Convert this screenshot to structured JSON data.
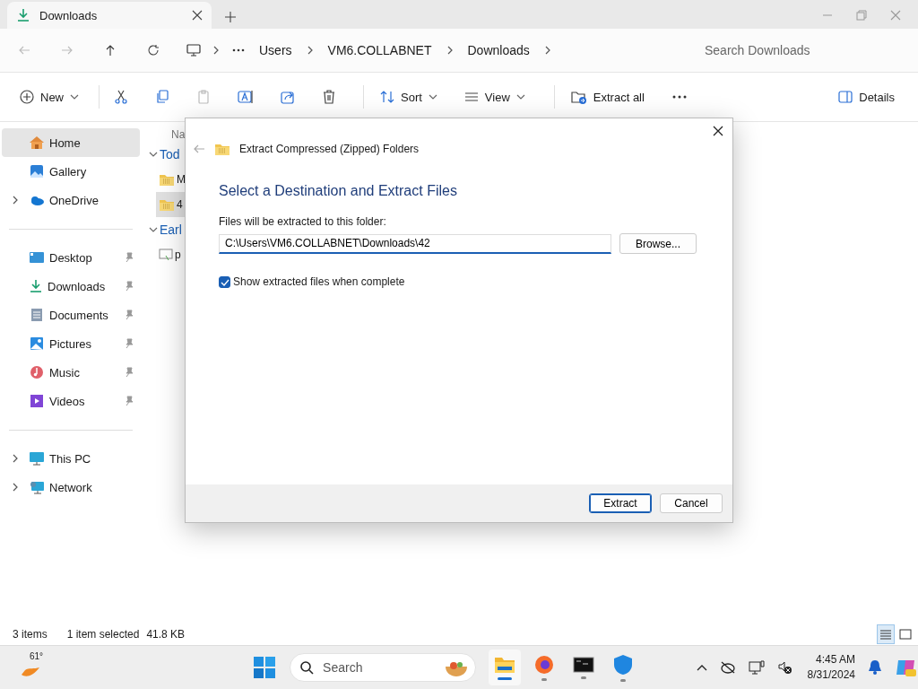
{
  "window": {
    "tab_title": "Downloads"
  },
  "address_bar": {
    "breadcrumbs": [
      "Users",
      "VM6.COLLABNET",
      "Downloads"
    ],
    "search": {
      "placeholder": "Search Downloads"
    }
  },
  "toolbar": {
    "new_label": "New",
    "paste_disabled": true,
    "sort_label": "Sort",
    "view_label": "View",
    "extract_label": "Extract all",
    "details_label": "Details"
  },
  "sidebar": {
    "groups": [
      {
        "items": [
          {
            "label": "Home",
            "selected": true,
            "expandable": false,
            "pinned": false
          },
          {
            "label": "Gallery",
            "selected": false,
            "expandable": false,
            "pinned": false
          },
          {
            "label": "OneDrive",
            "selected": false,
            "expandable": true,
            "pinned": false
          }
        ]
      },
      {
        "items": [
          {
            "label": "Desktop",
            "selected": false,
            "expandable": false,
            "pinned": true
          },
          {
            "label": "Downloads",
            "selected": false,
            "expandable": false,
            "pinned": true
          },
          {
            "label": "Documents",
            "selected": false,
            "expandable": false,
            "pinned": true
          },
          {
            "label": "Pictures",
            "selected": false,
            "expandable": false,
            "pinned": true
          },
          {
            "label": "Music",
            "selected": false,
            "expandable": false,
            "pinned": true
          },
          {
            "label": "Videos",
            "selected": false,
            "expandable": false,
            "pinned": true
          }
        ]
      },
      {
        "items": [
          {
            "label": "This PC",
            "selected": false,
            "expandable": true,
            "pinned": false
          },
          {
            "label": "Network",
            "selected": false,
            "expandable": true,
            "pinned": false
          }
        ]
      }
    ]
  },
  "content": {
    "column_1": "Na",
    "groups": [
      {
        "label": "Tod",
        "expanded": true,
        "items": [
          {
            "name": "M",
            "selected": false
          },
          {
            "name": "4",
            "selected": true
          }
        ]
      },
      {
        "label": "Earl",
        "expanded": true,
        "items": [
          {
            "name": "p",
            "selected": false
          }
        ]
      }
    ]
  },
  "dialog": {
    "title": "Extract Compressed (Zipped) Folders",
    "heading": "Select a Destination and Extract Files",
    "field_label": "Files will be extracted to this folder:",
    "path": "C:\\Users\\VM6.COLLABNET\\Downloads\\42",
    "browse": "Browse...",
    "show_files": {
      "label": "Show extracted files when complete",
      "checked": true
    },
    "buttons": [
      {
        "label": "Extract",
        "default": true
      },
      {
        "label": "Cancel",
        "default": false
      }
    ]
  },
  "status_bar": {
    "count": "3 items",
    "selection": "1 item selected",
    "size": "41.8 KB",
    "views": [
      {
        "selected": true
      },
      {
        "selected": false
      }
    ]
  },
  "taskbar": {
    "weather": "61°",
    "search": {
      "placeholder": "Search"
    },
    "apps": [
      {
        "active": true
      },
      {
        "active": false
      },
      {
        "active": false
      },
      {
        "active": false
      }
    ],
    "clock": {
      "time": "4:45 AM",
      "date": "8/31/2024"
    }
  }
}
